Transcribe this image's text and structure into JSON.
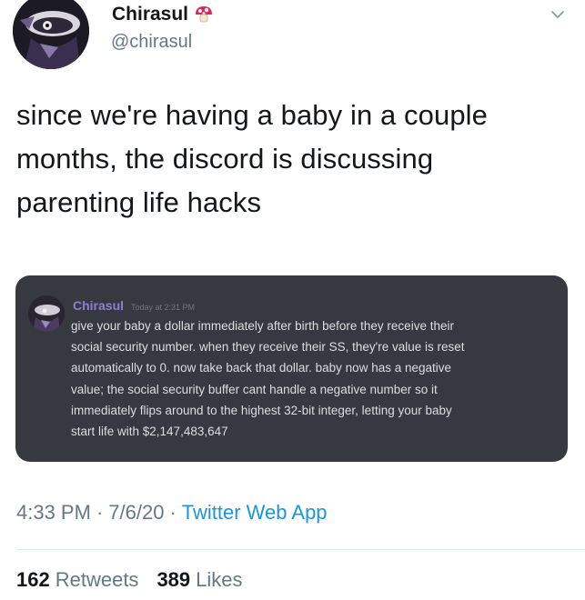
{
  "tweet": {
    "author": {
      "display_name": "Chirasul",
      "handle": "@chirasul",
      "badge_icon": "mushroom-icon"
    },
    "text_lines": [
      "since we're having a baby in a couple",
      "months, the discord is discussing",
      "parenting life hacks"
    ],
    "embedded_image": {
      "username": "Chirasul",
      "timestamp": "Today at 2:31 PM",
      "message_lines": [
        "give your baby a dollar immediately after birth before they receive their",
        "social security number. when they receive their SS, they're value is reset",
        "automatically to 0. now take back that dollar. baby now has a negative",
        "value; the social security buffer cant handle a negative number so it",
        "immediately flips around to the highest 32-bit integer, letting your baby",
        "start life with $2,147,483,647"
      ],
      "colors": {
        "background": "#36393f",
        "username": "#8e7fd4",
        "text": "#dcddde"
      }
    },
    "meta": {
      "time": "4:33 PM",
      "separator": "·",
      "date": "7/6/20",
      "source": "Twitter Web App"
    },
    "stats": {
      "retweets_count": "162",
      "retweets_label": "Retweets",
      "likes_count": "389",
      "likes_label": "Likes"
    }
  },
  "colors": {
    "link": "#1b95e0",
    "secondary_text": "#657786",
    "primary_text": "#14171a"
  }
}
